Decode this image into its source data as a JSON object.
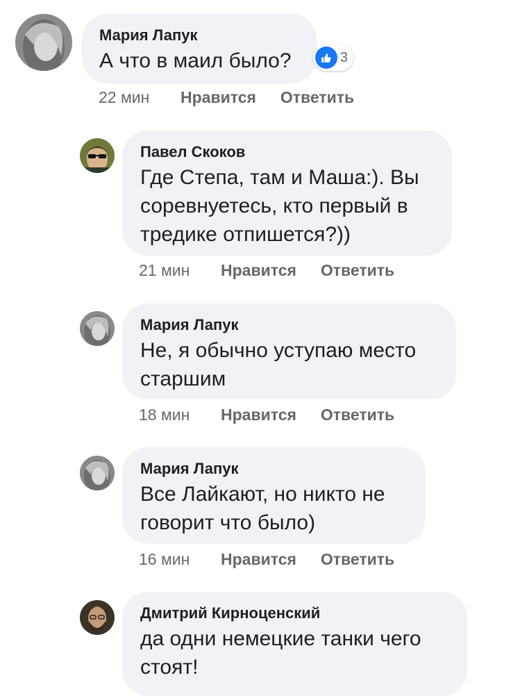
{
  "comments": [
    {
      "author": "Мария Лапук",
      "text": "А что в маил было?",
      "time": "22 мин",
      "like_label": "Нравится",
      "reply_label": "Ответить",
      "reactions": {
        "icon": "thumbs-up-icon",
        "count": "3"
      }
    },
    {
      "author": "Павел Скоков",
      "text": "Где Степа, там и Маша:). Вы\nсоревнуетесь, кто первый в\nтредике отпишется?))",
      "time": "21 мин",
      "like_label": "Нравится",
      "reply_label": "Ответить"
    },
    {
      "author": "Мария Лапук",
      "text": "Не, я обычно уступаю место\nстаршим",
      "time": "18 мин",
      "like_label": "Нравится",
      "reply_label": "Ответить"
    },
    {
      "author": "Мария Лапук",
      "text": "Все Лайкают, но никто не\nговорит что было)",
      "time": "16 мин",
      "like_label": "Нравится",
      "reply_label": "Ответить"
    },
    {
      "author": "Дмитрий Кирноценский",
      "text": "да одни немецкие танки чего\nстоят!"
    }
  ],
  "colors": {
    "bubble": "#f0f2f5",
    "meta_text": "#65676b",
    "like_blue": "#1877f2"
  }
}
